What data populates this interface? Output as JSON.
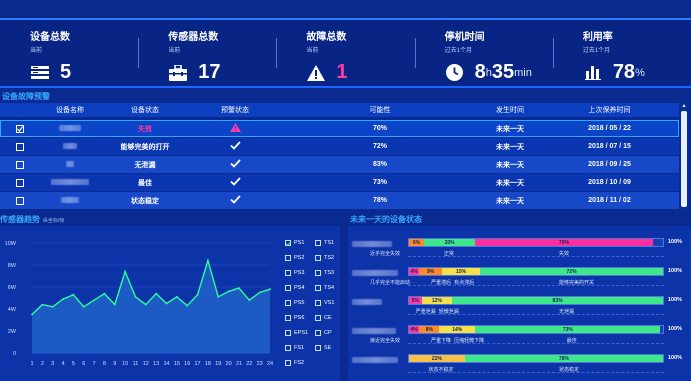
{
  "stats": [
    {
      "title": "设备总数",
      "sub": "当前",
      "value": "5",
      "unit": "",
      "icon": "server-list-icon"
    },
    {
      "title": "传感器总数",
      "sub": "当前",
      "value": "17",
      "unit": "",
      "icon": "toolbox-icon"
    },
    {
      "title": "故障总数",
      "sub": "当前",
      "value": "1",
      "unit": "",
      "icon": "warning-icon"
    },
    {
      "title": "停机时间",
      "sub": "过去1个月",
      "value_h": "8",
      "unit_h": "h",
      "value_m": "35",
      "unit_m": "min",
      "icon": "clock-icon"
    },
    {
      "title": "利用率",
      "sub": "过去1个月",
      "value": "78",
      "unit": "%",
      "icon": "bar-chart-icon"
    }
  ],
  "fault_section": {
    "title": "设备故障预警"
  },
  "table": {
    "headers": [
      "设备名称",
      "设备状态",
      "预警状态",
      "可能性",
      "发生时间",
      "上次保养时间"
    ],
    "rows": [
      {
        "status": "失效",
        "alert": "warning",
        "prob": "70%",
        "when": "未来一天",
        "last": "2018 / 05 / 22",
        "checked": true,
        "selected": true
      },
      {
        "status": "能够完美的打开",
        "alert": "check",
        "prob": "72%",
        "when": "未来一天",
        "last": "2018 / 07 / 15",
        "checked": false
      },
      {
        "status": "无泄漏",
        "alert": "check",
        "prob": "83%",
        "when": "未来一天",
        "last": "2018 / 09 / 25",
        "checked": false
      },
      {
        "status": "最佳",
        "alert": "check",
        "prob": "73%",
        "when": "未来一天",
        "last": "2018 / 10 / 09",
        "checked": false
      },
      {
        "status": "状态稳定",
        "alert": "check",
        "prob": "78%",
        "when": "未来一天",
        "last": "2018 / 11 / 02",
        "checked": false
      }
    ]
  },
  "sensor_section": {
    "title": "传感器趋势",
    "sub": "纵坐标/帧"
  },
  "device_section": {
    "title": "未来一天的设备状态"
  },
  "chart_data": {
    "type": "area",
    "x": [
      1,
      2,
      3,
      4,
      5,
      6,
      7,
      8,
      9,
      10,
      11,
      12,
      13,
      14,
      15,
      16,
      17,
      18,
      19,
      20,
      21,
      22,
      23,
      24
    ],
    "series": [
      {
        "name": "PS1",
        "values": [
          3.5,
          4.4,
          4.2,
          4.9,
          5.3,
          4.2,
          4.8,
          5.4,
          4.4,
          7.4,
          5.1,
          4.4,
          5.4,
          4.5,
          5.1,
          4.3,
          5.3,
          8.4,
          5.1,
          5.6,
          5.9,
          4.8,
          5.5,
          5.8
        ]
      }
    ],
    "ylim": [
      0,
      10
    ],
    "yticks": [
      "0",
      "2W",
      "4W",
      "6W",
      "8W",
      "10W"
    ],
    "xticks": [
      "1",
      "2",
      "3",
      "4",
      "5",
      "6",
      "7",
      "8",
      "9",
      "10",
      "11",
      "12",
      "13",
      "14",
      "15",
      "16",
      "17",
      "18",
      "19",
      "20",
      "21",
      "22",
      "23",
      "24"
    ],
    "grid": true
  },
  "legend": [
    {
      "label": "PS1",
      "checked": true
    },
    {
      "label": "TS1",
      "checked": false
    },
    {
      "label": "PS2",
      "checked": false
    },
    {
      "label": "TS2",
      "checked": false
    },
    {
      "label": "PS3",
      "checked": false
    },
    {
      "label": "TS3",
      "checked": false
    },
    {
      "label": "PS4",
      "checked": false
    },
    {
      "label": "TS4",
      "checked": false
    },
    {
      "label": "PS5",
      "checked": false
    },
    {
      "label": "VS1",
      "checked": false
    },
    {
      "label": "PS6",
      "checked": false
    },
    {
      "label": "CE",
      "checked": false
    },
    {
      "label": "EPS1",
      "checked": false
    },
    {
      "label": "CP",
      "checked": false
    },
    {
      "label": "FS1",
      "checked": false
    },
    {
      "label": "SE",
      "checked": false
    },
    {
      "label": "FS2",
      "checked": false
    }
  ],
  "device_status": [
    {
      "segments": [
        {
          "label": "6%",
          "color": "#ff8a2a",
          "pct": 6
        },
        {
          "label": "20%",
          "color": "#3ee88a",
          "pct": 20
        },
        {
          "label": "70%",
          "color": "#ff2fa0",
          "pct": 70
        }
      ],
      "total": "100%",
      "labels": [
        {
          "t": "近乎完全失效",
          "pos": 0
        },
        {
          "t": "正常",
          "pos": 14
        },
        {
          "t": "失效",
          "pos": 59
        }
      ]
    },
    {
      "segments": [
        {
          "label": "4%",
          "color": "#ff3aa5",
          "pct": 4
        },
        {
          "label": "9%",
          "color": "#ff8a2a",
          "pct": 9
        },
        {
          "label": "15%",
          "color": "#f4e04a",
          "pct": 15
        },
        {
          "label": "72%",
          "color": "#3ee88a",
          "pct": 72
        }
      ],
      "total": "100%",
      "labels": [
        {
          "t": "几乎完全不能启动",
          "pos": 0
        },
        {
          "t": "严重滞后",
          "pos": 9
        },
        {
          "t": "有点滞后",
          "pos": 18
        },
        {
          "t": "能够完美的开关",
          "pos": 59
        }
      ]
    },
    {
      "segments": [
        {
          "label": "5%",
          "color": "#ff3aa5",
          "pct": 5
        },
        {
          "label": "12%",
          "color": "#f4e04a",
          "pct": 12
        },
        {
          "label": "83%",
          "color": "#3ee88a",
          "pct": 83
        }
      ],
      "total": "100%",
      "labels": [
        {
          "t": "严重泄漏",
          "pos": 3
        },
        {
          "t": "轻微泄漏",
          "pos": 12
        },
        {
          "t": "无泄漏",
          "pos": 59
        }
      ]
    },
    {
      "segments": [
        {
          "label": "4%",
          "color": "#ff3aa5",
          "pct": 4
        },
        {
          "label": "8%",
          "color": "#ff8a2a",
          "pct": 8
        },
        {
          "label": "14%",
          "color": "#f4e04a",
          "pct": 14
        },
        {
          "label": "73%",
          "color": "#3ee88a",
          "pct": 73
        }
      ],
      "total": "100%",
      "labels": [
        {
          "t": "接近完全失效",
          "pos": 0
        },
        {
          "t": "严重下降",
          "pos": 9
        },
        {
          "t": "压缩轻微下降",
          "pos": 18
        },
        {
          "t": "最佳",
          "pos": 62
        }
      ]
    },
    {
      "segments": [
        {
          "label": "22%",
          "color": "#f4c14a",
          "pct": 22
        },
        {
          "label": "78%",
          "color": "#3ee88a",
          "pct": 78
        }
      ],
      "total": "100%",
      "labels": [
        {
          "t": "状态不稳定",
          "pos": 8
        },
        {
          "t": "状态稳定",
          "pos": 59
        }
      ]
    }
  ]
}
